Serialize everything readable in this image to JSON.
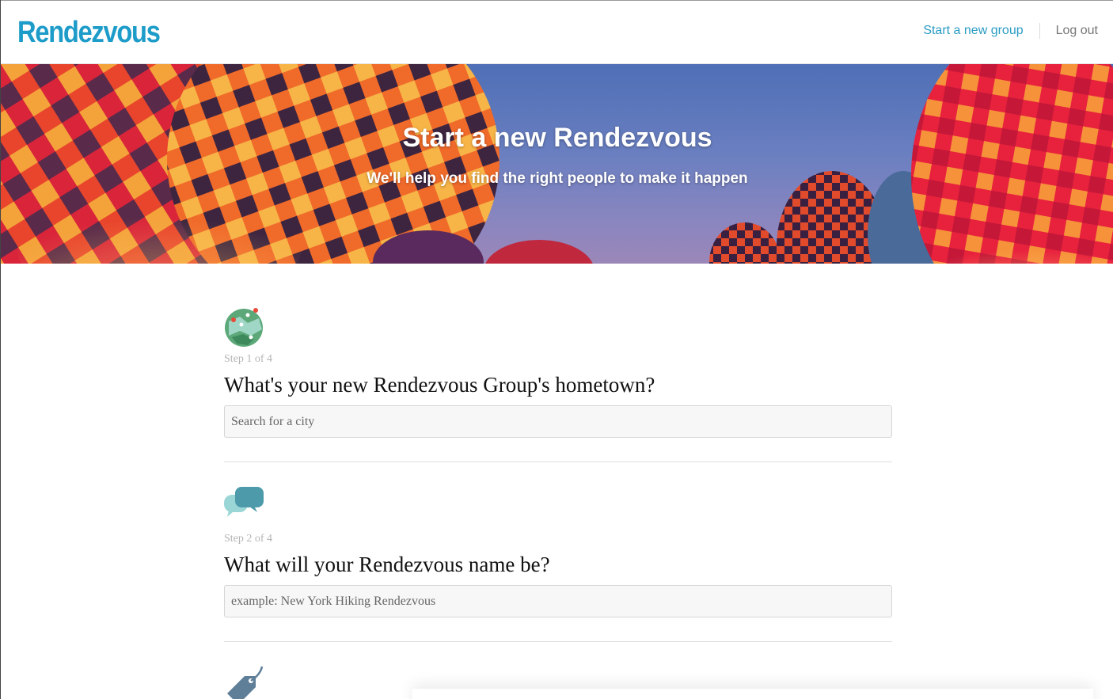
{
  "header": {
    "logo": "Rendezvous",
    "nav": {
      "start_group": "Start a new group",
      "logout": "Log out"
    }
  },
  "hero": {
    "title": "Start a new Rendezvous",
    "subtitle": "We'll help you find the right people to make it happen",
    "image": "hot-air-balloons"
  },
  "steps": [
    {
      "icon": "globe-map-icon",
      "count": "Step 1 of 4",
      "question": "What's your new Rendezvous Group's hometown?",
      "placeholder": "Search for a city",
      "value": ""
    },
    {
      "icon": "chat-bubbles-icon",
      "count": "Step 2 of 4",
      "question": "What will your Rendezvous name be?",
      "placeholder": "example: New York Hiking Rendezvous",
      "value": ""
    },
    {
      "icon": "tag-icon"
    }
  ],
  "colors": {
    "brand": "#1d9cc9",
    "link": "#2a9cc4",
    "muted": "#b4b4b4"
  }
}
